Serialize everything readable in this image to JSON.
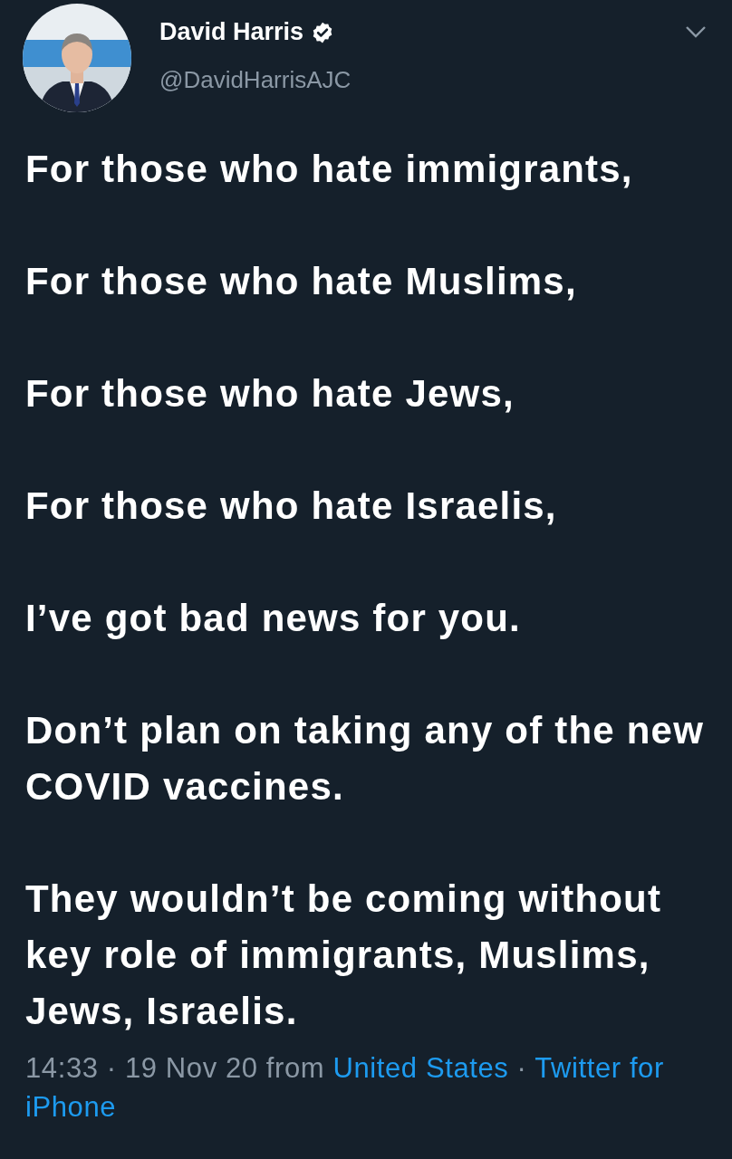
{
  "tweet": {
    "author": {
      "name": "David Harris",
      "handle": "@DavidHarrisAJC",
      "verified": true
    },
    "paragraphs": [
      "For those who hate immigrants,",
      "For those who hate Muslims,",
      "For those who hate Jews,",
      "For those who hate Israelis,",
      "I’ve got bad news for you.",
      "Don’t plan on taking any of the new COVID vaccines.",
      "They wouldn’t be coming without key role of immigrants, Muslims, Jews, Israelis."
    ],
    "meta": [
      {
        "kind": "text",
        "text": "14:33 · 19 Nov 20 from"
      },
      {
        "kind": "link",
        "text": "United States"
      },
      {
        "kind": "text",
        "text": "·"
      },
      {
        "kind": "link",
        "text": "Twitter for"
      },
      {
        "kind": "break"
      },
      {
        "kind": "link",
        "text": "iPhone"
      }
    ]
  }
}
